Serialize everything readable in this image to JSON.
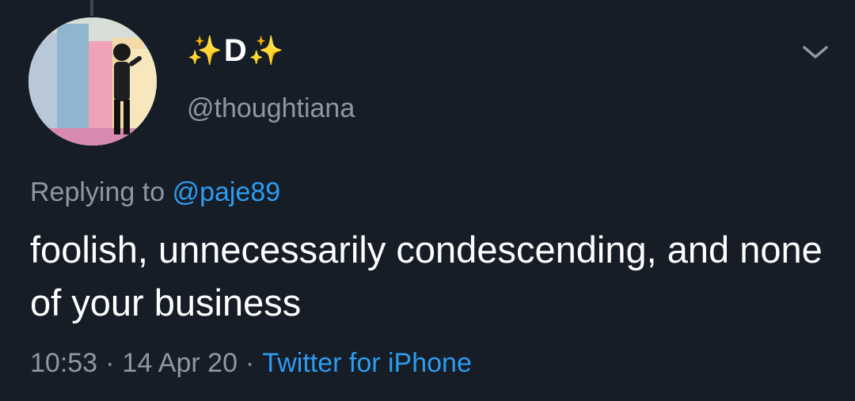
{
  "tweet": {
    "author": {
      "name_sparkle_left": "✨",
      "name_letter": "D",
      "name_sparkle_right": "✨",
      "handle": "@thoughtiana",
      "avatar_icon": "profile-photo"
    },
    "reply": {
      "prefix": "Replying to",
      "target_handle": "@paje89"
    },
    "text": "foolish, unnecessarily condescending, and none of your business",
    "meta": {
      "time": "10:53",
      "separator_1": "·",
      "date": "14 Apr 20",
      "separator_2": "·",
      "source": "Twitter for iPhone"
    },
    "menu_icon": "chevron-down-icon"
  },
  "colors": {
    "background": "#161d27",
    "primary_text": "#ffffff",
    "secondary_text": "#8d98a5",
    "link": "#2d9cf0",
    "sparkle": "#f7c948"
  }
}
